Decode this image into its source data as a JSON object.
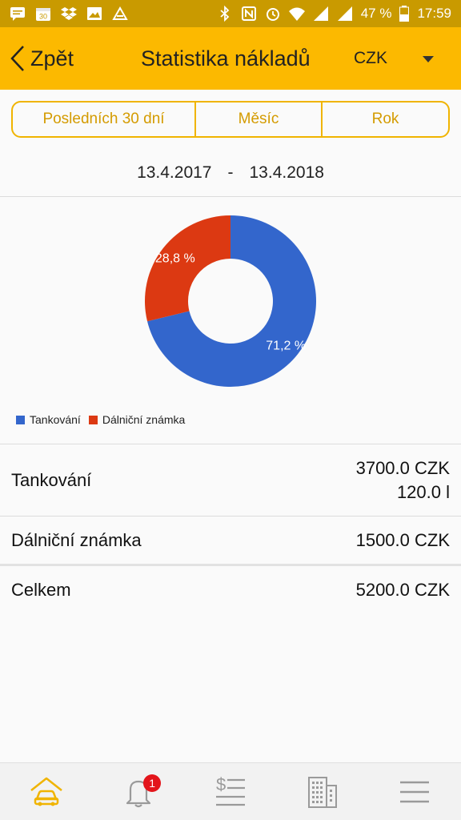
{
  "status_bar": {
    "battery": "47 %",
    "time": "17:59",
    "calendar_day": "30",
    "icons": [
      "message-icon",
      "calendar-icon",
      "dropbox-icon",
      "image-icon",
      "app-icon",
      "bluetooth-icon",
      "nfc-icon",
      "alarm-icon",
      "wifi-icon",
      "signal-icon",
      "signal-icon",
      "battery-icon"
    ]
  },
  "app_bar": {
    "back_label": "Zpět",
    "title": "Statistika nákladů",
    "currency": "CZK"
  },
  "period_tabs": [
    {
      "label": "Posledních 30 dní"
    },
    {
      "label": "Měsíc"
    },
    {
      "label": "Rok"
    }
  ],
  "date_range": {
    "from": "13.4.2017",
    "separator": "-",
    "to": "13.4.2018"
  },
  "chart_data": {
    "type": "pie",
    "donut": true,
    "categories": [
      "Tankování",
      "Dálniční známka"
    ],
    "values": [
      71.2,
      28.8
    ],
    "labels": [
      "71,2 %",
      "28,8 %"
    ],
    "colors": [
      "#3366cc",
      "#dc3912"
    ],
    "legend": "bottom-left"
  },
  "summary": {
    "rows": [
      {
        "label": "Tankování",
        "values": [
          "3700.0 CZK",
          "120.0 l"
        ]
      },
      {
        "label": "Dálniční známka",
        "values": [
          "1500.0 CZK"
        ]
      }
    ],
    "total": {
      "label": "Celkem",
      "value": "5200.0 CZK"
    }
  },
  "bottom_nav": {
    "items": [
      {
        "name": "car-home-icon",
        "color": "#f0b400"
      },
      {
        "name": "bell-icon",
        "badge": "1"
      },
      {
        "name": "expenses-list-icon"
      },
      {
        "name": "building-icon"
      },
      {
        "name": "hamburger-menu-icon"
      }
    ],
    "inactive_color": "#9a9a9a"
  }
}
